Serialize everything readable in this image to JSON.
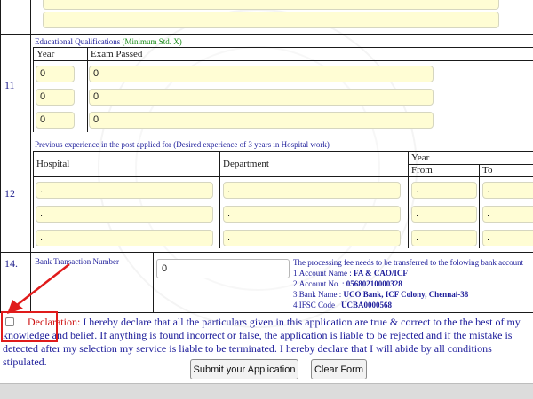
{
  "top_section": {
    "inputs": [
      "",
      ""
    ]
  },
  "row11": {
    "number": "11",
    "section_title": "Educational Qualifications",
    "section_note": "(Minimum Std. X)",
    "col_year": "Year",
    "col_exam": "Exam Passed",
    "rows": [
      {
        "year": "0",
        "exam": "0"
      },
      {
        "year": "0",
        "exam": "0"
      },
      {
        "year": "0",
        "exam": "0"
      }
    ]
  },
  "row12": {
    "number": "12",
    "section_title": "Previous experience in the post applied for",
    "section_note": "(Desired experience of 3 years in Hospital work)",
    "col_hospital": "Hospital",
    "col_department": "Department",
    "col_year": "Year",
    "col_from": "From",
    "col_to": "To",
    "rows": [
      {
        "hospital": ".",
        "department": ".",
        "from": ".",
        "to": "."
      },
      {
        "hospital": ".",
        "department": ".",
        "from": ".",
        "to": "."
      },
      {
        "hospital": ".",
        "department": ".",
        "from": ".",
        "to": "."
      }
    ]
  },
  "row14": {
    "number": "14.",
    "label": "Bank Transaction Number",
    "value": "0",
    "info_intro": "The processing fee needs to be transferred to the folowing bank account",
    "account_name_label": "1.Account Name : ",
    "account_name": "FA & CAO/ICF",
    "account_no_label": "2.Account No. : ",
    "account_no": "05680210000328",
    "bank_name_label": "3.Bank Name : ",
    "bank_name": "UCO Bank, ICF Colony, Chennai-38",
    "ifsc_label": "4.IFSC Code : ",
    "ifsc": "UCBA0000568"
  },
  "declaration": {
    "label": "Declaration:",
    "text": " I hereby declare that all the particulars given in this application are true & correct to the the best of my knowledge and belief. If anything is found incorrect or false, the application is liable to be rejected and if the mistake is detected after my selection my service is liable to be terminated. I hereby declare that I will abide by all conditions stipulated."
  },
  "buttons": {
    "submit": "Submit your Application",
    "clear": "Clear Form"
  },
  "colors": {
    "input_fill": "#fffdd4",
    "annotation_red": "#e01b1b",
    "declaration_red": "#cc1111",
    "text_blue": "#1a1a99",
    "note_green": "#168a16"
  }
}
